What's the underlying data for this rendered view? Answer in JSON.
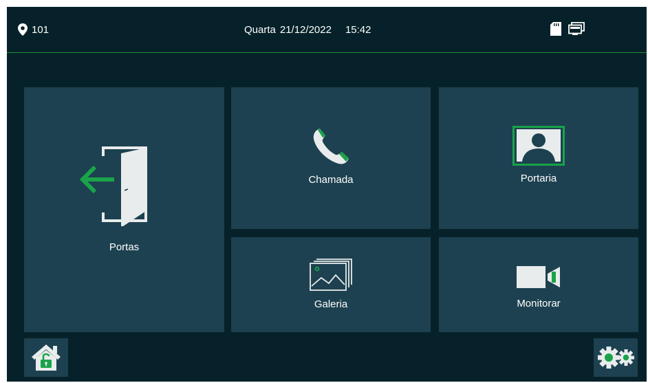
{
  "status_bar": {
    "location": "101",
    "weekday": "Quarta",
    "date": "21/12/2022",
    "time": "15:42"
  },
  "tiles": {
    "portas": {
      "label": "Portas",
      "icon": "door-exit-icon"
    },
    "chamada": {
      "label": "Chamada",
      "icon": "phone-icon"
    },
    "portaria": {
      "label": "Portaria",
      "icon": "contact-portrait-icon"
    },
    "galeria": {
      "label": "Galeria",
      "icon": "gallery-icon"
    },
    "monitorar": {
      "label": "Monitorar",
      "icon": "video-camera-icon"
    }
  },
  "buttons": {
    "home_unlock": {
      "icon": "home-unlock-icon"
    },
    "settings": {
      "icon": "gears-icon"
    }
  },
  "colors": {
    "background": "#062129",
    "tile": "#1d4150",
    "accent_green": "#1aa34a",
    "icon_light": "#e8ecec"
  }
}
